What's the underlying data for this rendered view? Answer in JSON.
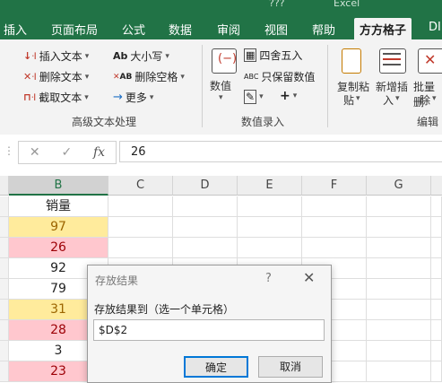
{
  "window": {
    "title_partial": "Excel",
    "name_partial": "???"
  },
  "tabs": [
    {
      "label": "插入"
    },
    {
      "label": "页面布局"
    },
    {
      "label": "公式"
    },
    {
      "label": "数据"
    },
    {
      "label": "审阅"
    },
    {
      "label": "视图"
    },
    {
      "label": "帮助"
    },
    {
      "label": "方方格子",
      "active": true
    },
    {
      "label": "DI"
    }
  ],
  "ribbon": {
    "text_group": {
      "label": "高级文本处理",
      "insert_text": "插入文本",
      "delete_text": "删除文本",
      "extract_text": "截取文本",
      "case": "大小写",
      "delete_space": "删除空格",
      "more": "更多",
      "case_icon": "Ab",
      "delete_space_icon": "AB"
    },
    "number_group": {
      "label": "数值录入",
      "number": "数值",
      "round": "四舍五入",
      "keep_number": "只保留数值",
      "keep_icon": "ABC",
      "plus": "+"
    },
    "edit_group": {
      "label": "编辑",
      "copy_paste": "复制粘贴",
      "copy_paste_l1": "复制粘",
      "copy_paste_l2": "贴",
      "add_insert_l1": "新增插",
      "add_insert_l2": "入",
      "batch_delete_l1": "批量删",
      "batch_delete_l2": "除"
    }
  },
  "formula_bar": {
    "fx": "fx",
    "value": "26"
  },
  "columns": [
    "B",
    "C",
    "D",
    "E",
    "F",
    "G"
  ],
  "rows": [
    {
      "value": "销量",
      "bg": "#ffffff",
      "color": "#222222"
    },
    {
      "value": "97",
      "bg": "#ffeb9c",
      "color": "#9c6500"
    },
    {
      "value": "26",
      "bg": "#ffc7ce",
      "color": "#9c0006"
    },
    {
      "value": "92",
      "bg": "#ffffff",
      "color": "#222222"
    },
    {
      "value": "79",
      "bg": "#ffffff",
      "color": "#222222"
    },
    {
      "value": "31",
      "bg": "#ffeb9c",
      "color": "#9c6500"
    },
    {
      "value": "28",
      "bg": "#ffc7ce",
      "color": "#9c0006"
    },
    {
      "value": "3",
      "bg": "#ffffff",
      "color": "#222222"
    },
    {
      "value": "23",
      "bg": "#ffc7ce",
      "color": "#9c0006"
    }
  ],
  "dialog": {
    "title": "存放结果",
    "help": "?",
    "close": "✕",
    "label": "存放结果到（选一个单元格）",
    "input_value": "$D$2",
    "ok": "确定",
    "cancel": "取消"
  },
  "colors": {
    "accent": "#217346",
    "focus": "#0078d7"
  }
}
